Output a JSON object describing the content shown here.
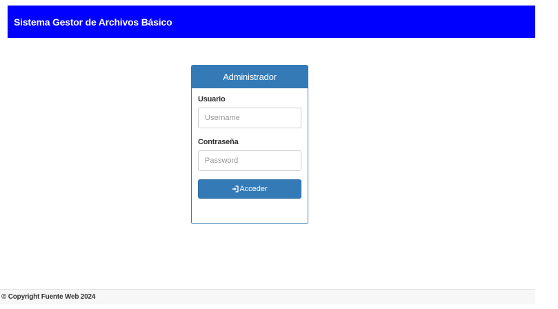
{
  "navbar": {
    "brand": "Sistema Gestor de Archivos Básico",
    "background_color": "#0000ff"
  },
  "login_panel": {
    "heading": "Administrador",
    "accent_color": "#337ab7",
    "username": {
      "label": "Usuario",
      "placeholder": "Username",
      "value": ""
    },
    "password": {
      "label": "Contraseña",
      "placeholder": "Password",
      "value": ""
    },
    "submit": {
      "label": "Acceder",
      "icon": "sign-in-icon"
    }
  },
  "footer": {
    "text": "© Copyright Fuente Web 2024"
  }
}
